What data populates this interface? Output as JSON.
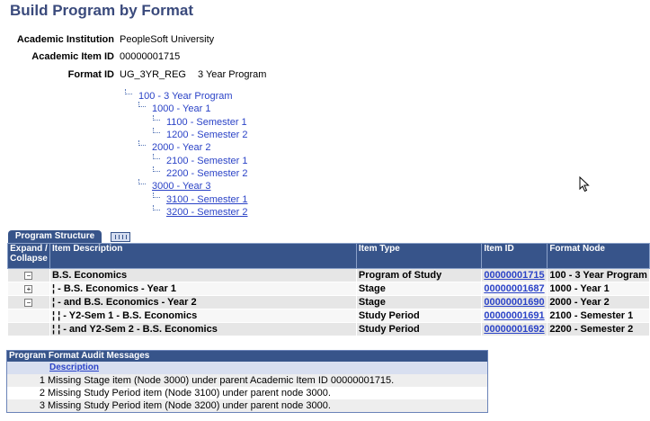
{
  "page": {
    "title": "Build Program by Format"
  },
  "fields": [
    {
      "label": "Academic Institution",
      "value": "PeopleSoft University"
    },
    {
      "label": "Academic Item ID",
      "value": "00000001715"
    },
    {
      "label": "Format ID",
      "value": "UG_3YR_REG",
      "value2": "3 Year Program"
    }
  ],
  "tree": [
    {
      "label": "100 - 3 Year Program",
      "level": 0
    },
    {
      "label": "1000 - Year 1",
      "level": 1
    },
    {
      "label": "1100 - Semester 1",
      "level": 2
    },
    {
      "label": "1200 - Semester 2",
      "level": 2
    },
    {
      "label": "2000 - Year 2",
      "level": 1
    },
    {
      "label": "2100 - Semester 1",
      "level": 2
    },
    {
      "label": "2200 - Semester 2",
      "level": 2
    },
    {
      "label": "3000 - Year 3",
      "level": 1
    },
    {
      "label": "3100 - Semester 1",
      "level": 2
    },
    {
      "label": "3200 - Semester 2",
      "level": 2
    }
  ],
  "grid": {
    "tab_label": "Program Structure",
    "columns": [
      "Expand / Collapse",
      "Item Description",
      "Item Type",
      "Item ID",
      "Format Node"
    ],
    "rows": [
      {
        "toggle": "−",
        "description": "B.S. Economics",
        "type": "Program of Study",
        "item_id": "00000001715",
        "node": "100 - 3 Year Program"
      },
      {
        "toggle": "+",
        "description": "¦ -  B.S. Economics - Year 1",
        "type": "Stage",
        "item_id": "00000001687",
        "node": "1000 - Year 1"
      },
      {
        "toggle": "−",
        "description": "¦ -  and B.S. Economics - Year 2",
        "type": "Stage",
        "item_id": "00000001690",
        "node": "2000 - Year 2"
      },
      {
        "toggle": "",
        "description": "¦   ¦ -  Y2-Sem 1 - B.S. Economics",
        "type": "Study Period",
        "item_id": "00000001691",
        "node": "2100 - Semester 1"
      },
      {
        "toggle": "",
        "description": "¦   ¦ -  and Y2-Sem 2 - B.S. Economics",
        "type": "Study Period",
        "item_id": "00000001692",
        "node": "2200 - Semester 2"
      }
    ]
  },
  "audit": {
    "title": "Program Format Audit Messages",
    "column": "Description",
    "messages": [
      {
        "num": "1",
        "text": "Missing Stage item (Node 3000) under parent Academic Item ID 00000001715."
      },
      {
        "num": "2",
        "text": "Missing Study Period item (Node 3100) under parent node 3000."
      },
      {
        "num": "3",
        "text": "Missing Study Period item (Node 3200) under parent node 3000."
      }
    ]
  }
}
